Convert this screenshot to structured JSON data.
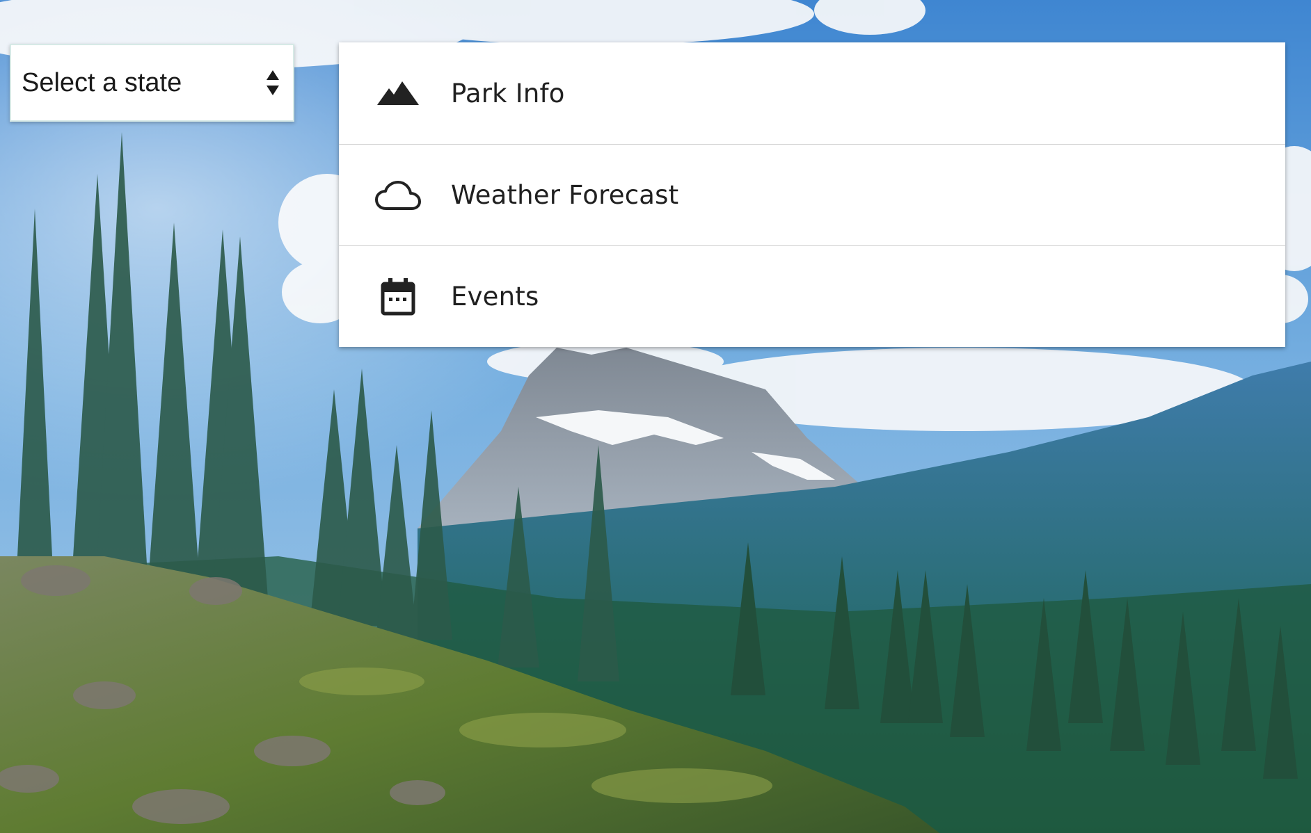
{
  "state_select": {
    "label": "Select a state",
    "icon": "select-arrows-icon"
  },
  "menu": {
    "items": [
      {
        "label": "Park Info",
        "icon": "mountain-icon"
      },
      {
        "label": "Weather Forecast",
        "icon": "cloud-icon"
      },
      {
        "label": "Events",
        "icon": "calendar-icon"
      }
    ]
  },
  "background": {
    "description_colors": {
      "sky": "#5f9fd8",
      "cloud": "#f4f7fa",
      "mountain": "#8d98a3",
      "forest": "#2f6d53",
      "hillside": "#6f8a3c"
    }
  }
}
